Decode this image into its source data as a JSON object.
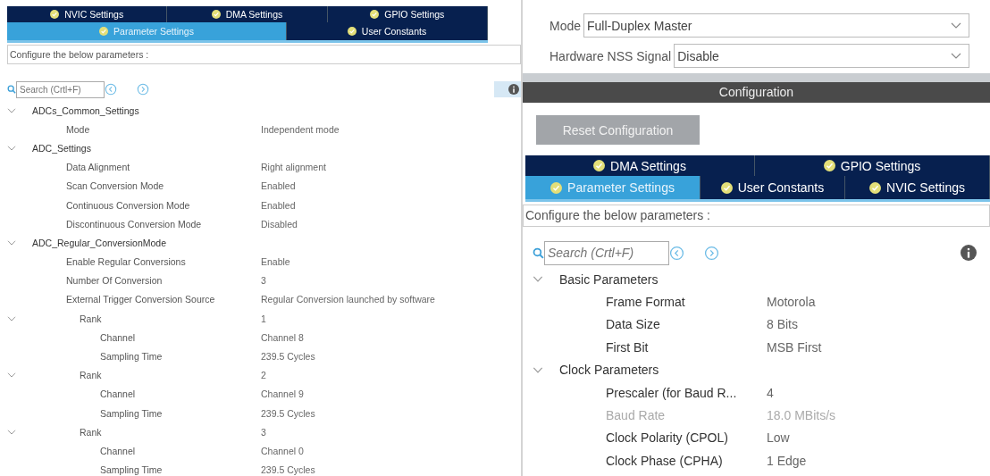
{
  "left_panel": {
    "tab_rows": [
      [
        {
          "label": "NVIC Settings",
          "selected": false
        },
        {
          "label": "DMA Settings",
          "selected": false
        },
        {
          "label": "GPIO Settings",
          "selected": false
        }
      ],
      [
        {
          "label": "Parameter Settings",
          "selected": true
        },
        {
          "label": "User Constants",
          "selected": false
        }
      ]
    ],
    "description": "Configure the below parameters :",
    "search": {
      "placeholder": "Search (Crtl+F)"
    },
    "tree": [
      {
        "label": "ADCs_Common_Settings",
        "expanded": true,
        "children": [
          {
            "label": "Mode",
            "value": "Independent mode"
          }
        ]
      },
      {
        "label": "ADC_Settings",
        "expanded": true,
        "children": [
          {
            "label": "Data Alignment",
            "value": "Right alignment"
          },
          {
            "label": "Scan Conversion Mode",
            "value": "Enabled"
          },
          {
            "label": "Continuous Conversion Mode",
            "value": "Enabled"
          },
          {
            "label": "Discontinuous Conversion Mode",
            "value": "Disabled"
          }
        ]
      },
      {
        "label": "ADC_Regular_ConversionMode",
        "expanded": true,
        "children": [
          {
            "label": "Enable Regular Conversions",
            "value": "Enable"
          },
          {
            "label": "Number Of Conversion",
            "value": "3"
          },
          {
            "label": "External Trigger Conversion Source",
            "value": "Regular Conversion launched by software"
          },
          {
            "label": "Rank",
            "value": "1",
            "expanded": true,
            "children": [
              {
                "label": "Channel",
                "value": "Channel 8"
              },
              {
                "label": "Sampling Time",
                "value": "239.5 Cycles"
              }
            ]
          },
          {
            "label": "Rank",
            "value": "2",
            "expanded": true,
            "children": [
              {
                "label": "Channel",
                "value": "Channel 9"
              },
              {
                "label": "Sampling Time",
                "value": "239.5 Cycles"
              }
            ]
          },
          {
            "label": "Rank",
            "value": "3",
            "expanded": true,
            "children": [
              {
                "label": "Channel",
                "value": "Channel 0"
              },
              {
                "label": "Sampling Time",
                "value": "239.5 Cycles"
              }
            ]
          }
        ]
      }
    ]
  },
  "right_panel": {
    "fields": [
      {
        "label": "Mode",
        "value": "Full-Duplex Master"
      },
      {
        "label": "Hardware NSS Signal",
        "value": "Disable"
      }
    ],
    "section_title": "Configuration",
    "reset_button": "Reset Configuration",
    "tab_rows": [
      [
        {
          "label": "DMA Settings",
          "selected": false
        },
        {
          "label": "GPIO Settings",
          "selected": false
        }
      ],
      [
        {
          "label": "Parameter Settings",
          "selected": true
        },
        {
          "label": "User Constants",
          "selected": false
        },
        {
          "label": "NVIC Settings",
          "selected": false
        }
      ]
    ],
    "description": "Configure the below parameters :",
    "search": {
      "placeholder": "Search (Crtl+F)"
    },
    "tree": [
      {
        "label": "Basic Parameters",
        "expanded": true,
        "children": [
          {
            "label": "Frame Format",
            "value": "Motorola",
            "disabled": false
          },
          {
            "label": "Data Size",
            "value": "8 Bits",
            "disabled": false
          },
          {
            "label": "First Bit",
            "value": "MSB First",
            "disabled": false
          }
        ]
      },
      {
        "label": "Clock Parameters",
        "expanded": true,
        "children": [
          {
            "label": "Prescaler (for Baud R...",
            "value": "4",
            "disabled": false
          },
          {
            "label": "Baud Rate",
            "value": "18.0 MBits/s",
            "disabled": true
          },
          {
            "label": "Clock Polarity (CPOL)",
            "value": "Low",
            "disabled": false
          },
          {
            "label": "Clock Phase (CPHA)",
            "value": "1 Edge",
            "disabled": false
          }
        ]
      }
    ]
  }
}
